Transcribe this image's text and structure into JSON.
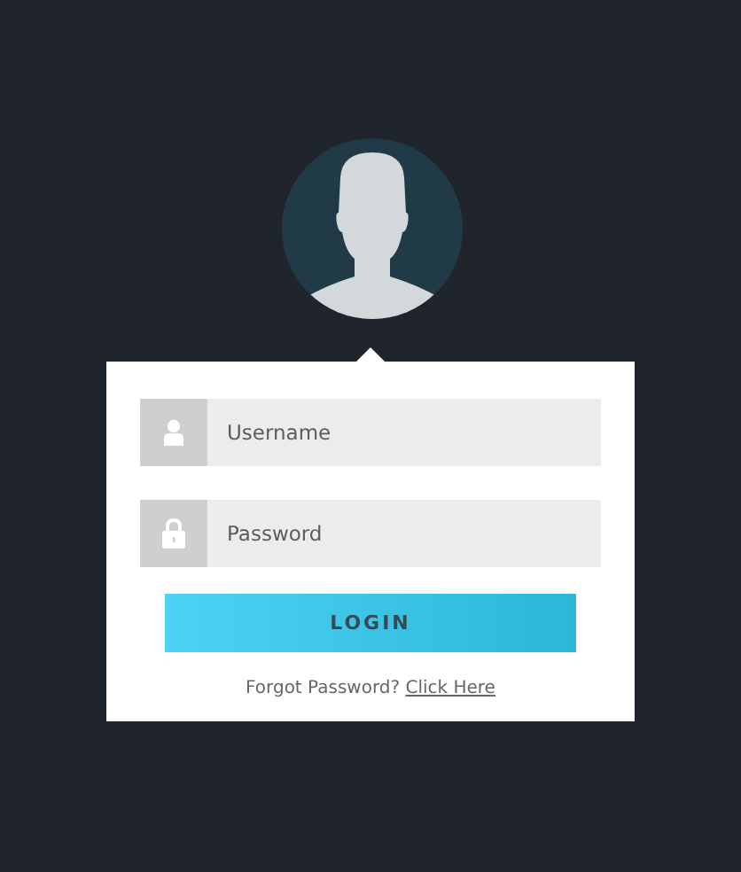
{
  "fields": [
    {
      "kind": "text",
      "placeholder": "Username"
    },
    {
      "kind": "password",
      "placeholder": "Password"
    }
  ],
  "login_button": "LOGIN",
  "forgot": {
    "text": "Forgot Password?",
    "link": "Click Here"
  }
}
